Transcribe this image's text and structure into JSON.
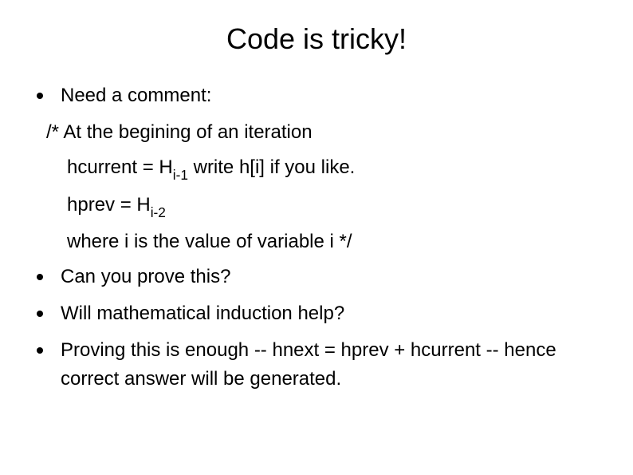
{
  "title": "Code is tricky!",
  "bullets": {
    "b1": "Need a comment:",
    "b2": "Can you prove this?",
    "b3": "Will mathematical induction help?",
    "b4": "Proving this is enough -- hnext = hprev + hcurrent -- hence correct answer will be generated."
  },
  "comment": {
    "line1": "/* At the begining of  an iteration",
    "line2_pre": "hcurrent = H",
    "line2_sub": "i-1",
    "line2_post": "   write h[i] if you like.",
    "line3_pre": "hprev      = H",
    "line3_sub": "i-2",
    "line4": "where i is the value of variable i  */"
  }
}
